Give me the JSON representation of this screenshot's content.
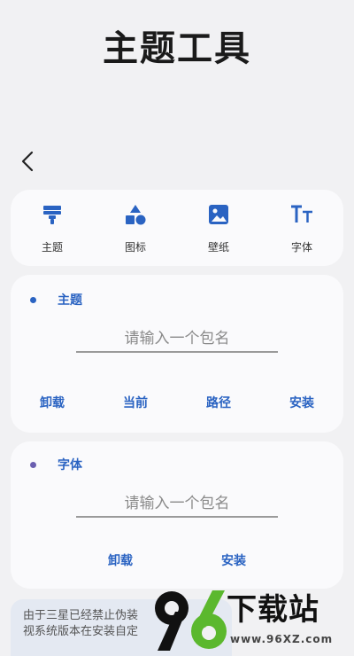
{
  "header": {
    "title": "主题工具"
  },
  "tabs": [
    {
      "label": "主题",
      "icon": "brush-icon"
    },
    {
      "label": "图标",
      "icon": "shapes-icon"
    },
    {
      "label": "壁纸",
      "icon": "image-icon"
    },
    {
      "label": "字体",
      "icon": "font-icon"
    }
  ],
  "theme_section": {
    "title": "主题",
    "dot_color": "#2a63c2",
    "input_placeholder": "请输入一个包名",
    "actions": [
      "卸载",
      "当前",
      "路径",
      "安装"
    ]
  },
  "font_section": {
    "title": "字体",
    "dot_color": "#6a5fb0",
    "input_placeholder": "请输入一个包名",
    "actions": [
      "卸载",
      "安装"
    ]
  },
  "notice": {
    "line1": "由于三星已经禁止伪装",
    "line2": "视系统版本在安装自定"
  },
  "watermark": {
    "number": "96",
    "text": "下载站",
    "url": "www.96XZ.com"
  },
  "colors": {
    "accent": "#2a63c2",
    "background": "#f1f1f3",
    "card": "#fafafc"
  }
}
